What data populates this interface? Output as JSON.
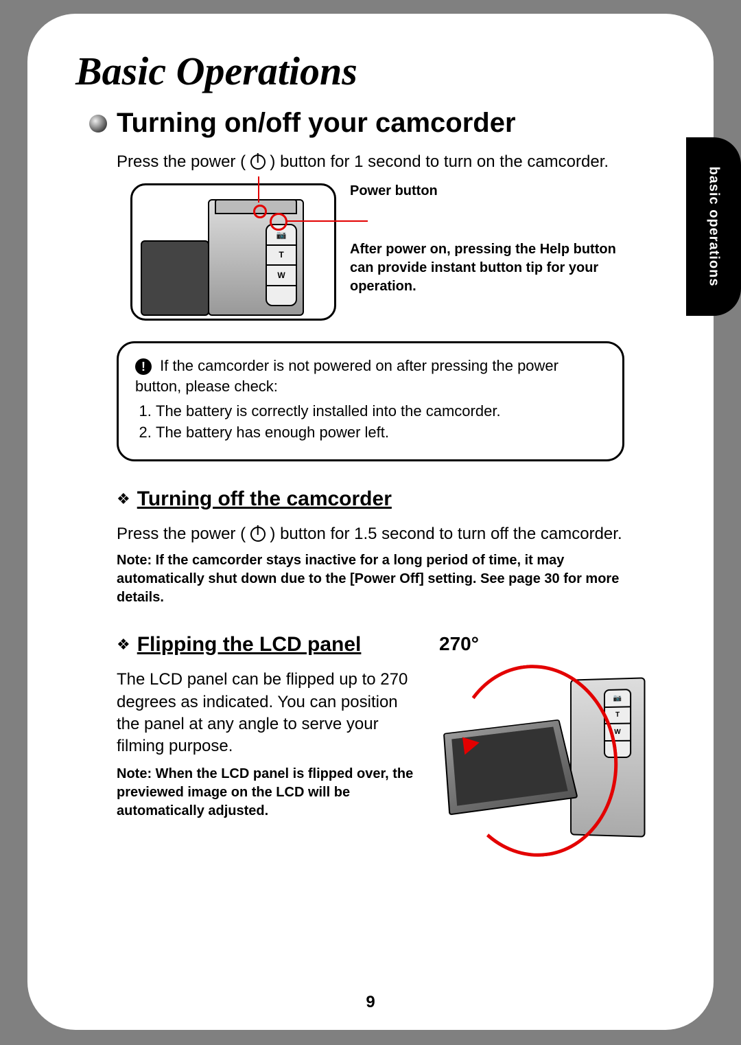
{
  "side_tab": "basic operations",
  "chapter_title": "Basic Operations",
  "section1": {
    "heading": "Turning on/off your camcorder",
    "intro_pre": "Press the power (",
    "intro_post": ") button for 1 second to turn on the camcorder.",
    "power_button_label": "Power button",
    "help_text": "After power on, pressing the Help button can provide instant button tip for your operation.",
    "camera_button_labels": [
      "📷",
      "T",
      "W",
      ""
    ]
  },
  "note_box": {
    "intro": "If the camcorder is not powered on after pressing the power button, please check:",
    "items": [
      "The battery is correctly installed into the camcorder.",
      "The battery has enough power left."
    ]
  },
  "section2": {
    "heading": "Turning off the camcorder",
    "text_pre": "Press the power (",
    "text_post": ") button for 1.5 second to turn off the camcorder.",
    "note": "Note: If the camcorder stays inactive for a long period of time, it may automatically shut down due to the [Power Off] setting. See page 30 for more details."
  },
  "section3": {
    "heading": "Flipping the LCD panel",
    "angle_label": "270°",
    "text": "The LCD panel can be flipped up to 270 degrees as indicated. You can position the panel at any angle to serve your filming purpose.",
    "note": "Note: When the LCD panel is flipped over, the previewed image on the LCD will be automatically adjusted.",
    "camera_button_labels": [
      "📷",
      "T",
      "W",
      ""
    ]
  },
  "page_number": "9"
}
